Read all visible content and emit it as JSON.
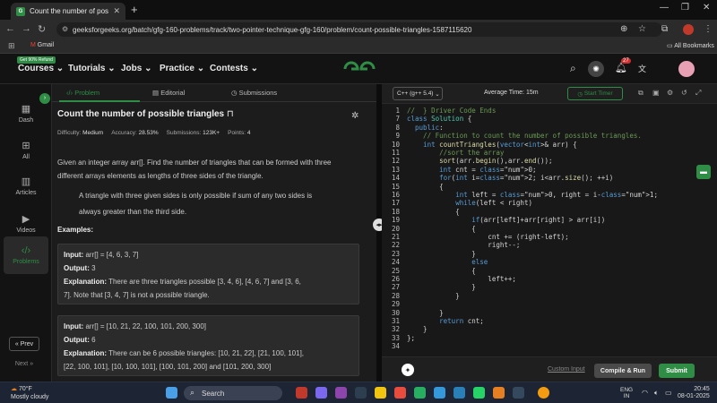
{
  "browser": {
    "tab_title": "Count the number of possible t",
    "url": "geeksforgeeks.org/batch/gfg-160-problems/track/two-pointer-technique-gfg-160/problem/count-possible-triangles-1587115620",
    "bookmark_gmail": "Gmail",
    "all_bookmarks": "All Bookmarks",
    "ext_badge": "2"
  },
  "site": {
    "promo_badge": "Get 90% Refund",
    "nav": [
      "Courses",
      "Tutorials",
      "Jobs",
      "Practice",
      "Contests"
    ],
    "notif_count": "27",
    "brand_color": "#2f8d46"
  },
  "rail": {
    "items": [
      "Dash",
      "All",
      "Articles",
      "Videos",
      "Problems"
    ],
    "prev": "Prev",
    "next": "Next"
  },
  "problem": {
    "tabs": [
      "Problem",
      "Editorial",
      "Submissions"
    ],
    "title": "Count the number of possible triangles",
    "difficulty_label": "Difficulty:",
    "difficulty": "Medium",
    "accuracy_label": "Accuracy:",
    "accuracy": "28.53%",
    "submissions_label": "Submissions:",
    "submissions": "123K+",
    "points_label": "Points:",
    "points": "4",
    "desc_1": "Given an integer array arr[]. Find the number of triangles that can be formed with three",
    "desc_2": "different arrays elements as lengths of three sides of the triangle.",
    "note_1": "A triangle with three given sides is only possible if sum of any two sides is",
    "note_2": "always greater than the third side.",
    "examples_heading": "Examples:",
    "ex1": {
      "input_label": "Input:",
      "input": "arr[] = [4, 6, 3, 7]",
      "output_label": "Output:",
      "output": "3",
      "expl_label": "Explanation:",
      "expl_1": "There are three triangles possible [3, 4, 6], [4, 6, 7] and [3, 6,",
      "expl_2": "7]. Note that [3, 4, 7] is not a possible triangle."
    },
    "ex2": {
      "input_label": "Input:",
      "input": "arr[] = [10, 21, 22, 100, 101, 200, 300]",
      "output_label": "Output:",
      "output": "6",
      "expl_label": "Explanation:",
      "expl_1": "There can be 6 possible triangles: [10, 21, 22], [21, 100, 101],",
      "expl_2": "[22, 100, 101], [10, 100, 101], [100, 101, 200] and [101, 200, 300]"
    }
  },
  "editor": {
    "language": "C++ (g++ 5.4)",
    "avg_time_label": "Average Time:",
    "avg_time": "15m",
    "start_timer": "Start Timer",
    "custom_input": "Custom Input",
    "compile_run": "Compile & Run",
    "submit": "Submit",
    "lines": [
      {
        "n": "1",
        "t": "//  } Driver Code Ends"
      },
      {
        "n": "7",
        "t": "class Solution {"
      },
      {
        "n": "8",
        "t": "  public:"
      },
      {
        "n": "9",
        "t": "    // Function to count the number of possible triangles."
      },
      {
        "n": "10",
        "t": "    int countTriangles(vector<int>& arr) {"
      },
      {
        "n": "11",
        "t": "        //sort the array"
      },
      {
        "n": "12",
        "t": "        sort(arr.begin(),arr.end());"
      },
      {
        "n": "13",
        "t": "        int cnt = 0;"
      },
      {
        "n": "14",
        "t": "        for(int i=2; i<arr.size(); ++i)"
      },
      {
        "n": "15",
        "t": "        {"
      },
      {
        "n": "16",
        "t": "            int left = 0, right = i-1;"
      },
      {
        "n": "17",
        "t": "            while(left < right)"
      },
      {
        "n": "18",
        "t": "            {"
      },
      {
        "n": "19",
        "t": "                if(arr[left]+arr[right] > arr[i])"
      },
      {
        "n": "20",
        "t": "                {"
      },
      {
        "n": "21",
        "t": "                    cnt += (right-left);"
      },
      {
        "n": "22",
        "t": "                    right--;"
      },
      {
        "n": "23",
        "t": "                }"
      },
      {
        "n": "24",
        "t": "                else"
      },
      {
        "n": "25",
        "t": "                {"
      },
      {
        "n": "26",
        "t": "                    left++;"
      },
      {
        "n": "27",
        "t": "                }"
      },
      {
        "n": "28",
        "t": "            }"
      },
      {
        "n": "29",
        "t": ""
      },
      {
        "n": "30",
        "t": "        }"
      },
      {
        "n": "31",
        "t": "        return cnt;"
      },
      {
        "n": "32",
        "t": "    }"
      },
      {
        "n": "33",
        "t": "};"
      },
      {
        "n": "34",
        "t": ""
      }
    ]
  },
  "taskbar": {
    "temp": "70°F",
    "weather": "Mostly cloudy",
    "search": "Search",
    "lang_1": "ENG",
    "lang_2": "IN",
    "time": "20:45",
    "date": "08-01-2025"
  }
}
